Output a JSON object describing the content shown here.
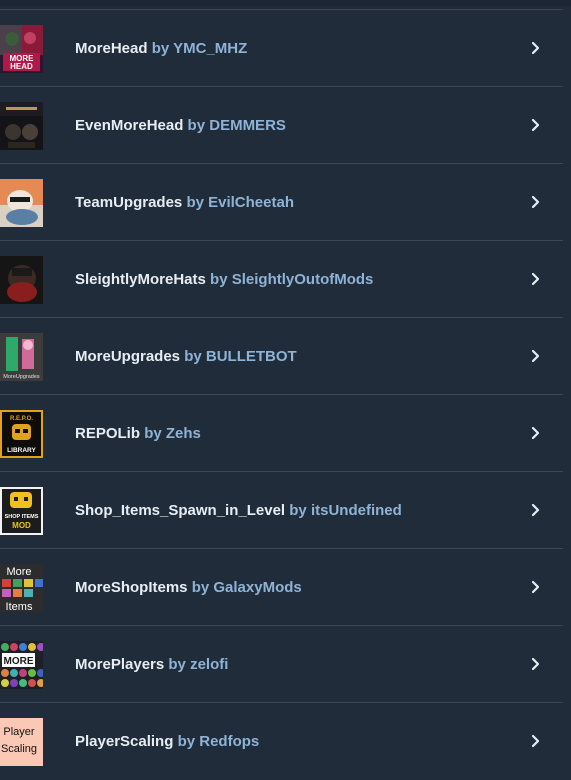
{
  "mods": [
    {
      "name": "MoreHead",
      "by": "by",
      "author": "YMC_MHZ",
      "thumb_text": "MORE HEAD"
    },
    {
      "name": "EvenMoreHead",
      "by": "by",
      "author": "DEMMERS"
    },
    {
      "name": "TeamUpgrades",
      "by": "by",
      "author": "EvilCheetah"
    },
    {
      "name": "SleightlyMoreHats",
      "by": "by",
      "author": "SleightlyOutofMods"
    },
    {
      "name": "MoreUpgrades",
      "by": "by",
      "author": "BULLETBOT",
      "thumb_text": "MoreUpgrades"
    },
    {
      "name": "REPOLib",
      "by": "by",
      "author": "Zehs",
      "thumb_text": "R.E.P.O. LIBRARY"
    },
    {
      "name": "Shop_Items_Spawn_in_Level",
      "by": "by",
      "author": "itsUndefined",
      "thumb_text": "SHOP ITEMS MOD"
    },
    {
      "name": "MoreShopItems",
      "by": "by",
      "author": "GalaxyMods",
      "thumb_text": "More Items"
    },
    {
      "name": "MorePlayers",
      "by": "by",
      "author": "zelofi",
      "thumb_text": "MORE"
    },
    {
      "name": "PlayerScaling",
      "by": "by",
      "author": "Redfops",
      "thumb_text": "Player Scaling"
    }
  ],
  "icons": {
    "chevron": "chevron-right-icon"
  },
  "colors": {
    "background": "#202c3a",
    "name_text": "#e6edf3",
    "author_text": "#8fb3d6",
    "divider": "#3a4756"
  }
}
